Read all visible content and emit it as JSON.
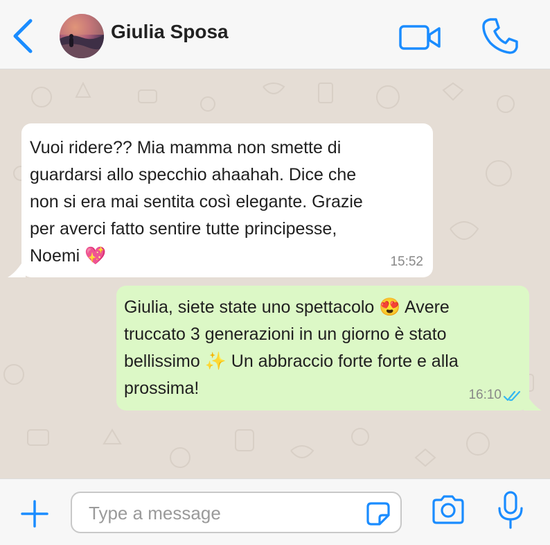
{
  "header": {
    "contact_name": "Giulia Sposa",
    "icons": [
      "back-chevron-icon",
      "avatar",
      "video-call-icon",
      "phone-icon"
    ]
  },
  "messages": [
    {
      "direction": "incoming",
      "text": "Vuoi ridere?? Mia mamma non smette di\nguardarsi allo specchio ahaahah. Dice che\nnon si era mai sentita così elegante. Grazie\nper averci fatto sentire tutte principesse,\nNoemi 💖",
      "time": "15:52"
    },
    {
      "direction": "outgoing",
      "text": "Giulia, siete state uno spettacolo 😍 Avere\ntruccato 3 generazioni in un giorno è stato\nbellissimo ✨ Un abbraccio forte forte e alla\nprossima!",
      "time": "16:10",
      "status_icon": "double-check-icon"
    }
  ],
  "footer": {
    "input_placeholder": "Type a message",
    "input_value": "",
    "icons": [
      "plus-icon",
      "sticker-icon",
      "camera-icon",
      "microphone-icon"
    ]
  },
  "colors": {
    "accent": "#1a8cff",
    "chat_background": "#e5ddd5",
    "incoming_bubble": "#ffffff",
    "outgoing_bubble": "#dcf8c6",
    "read_ticks": "#34b7f1"
  }
}
